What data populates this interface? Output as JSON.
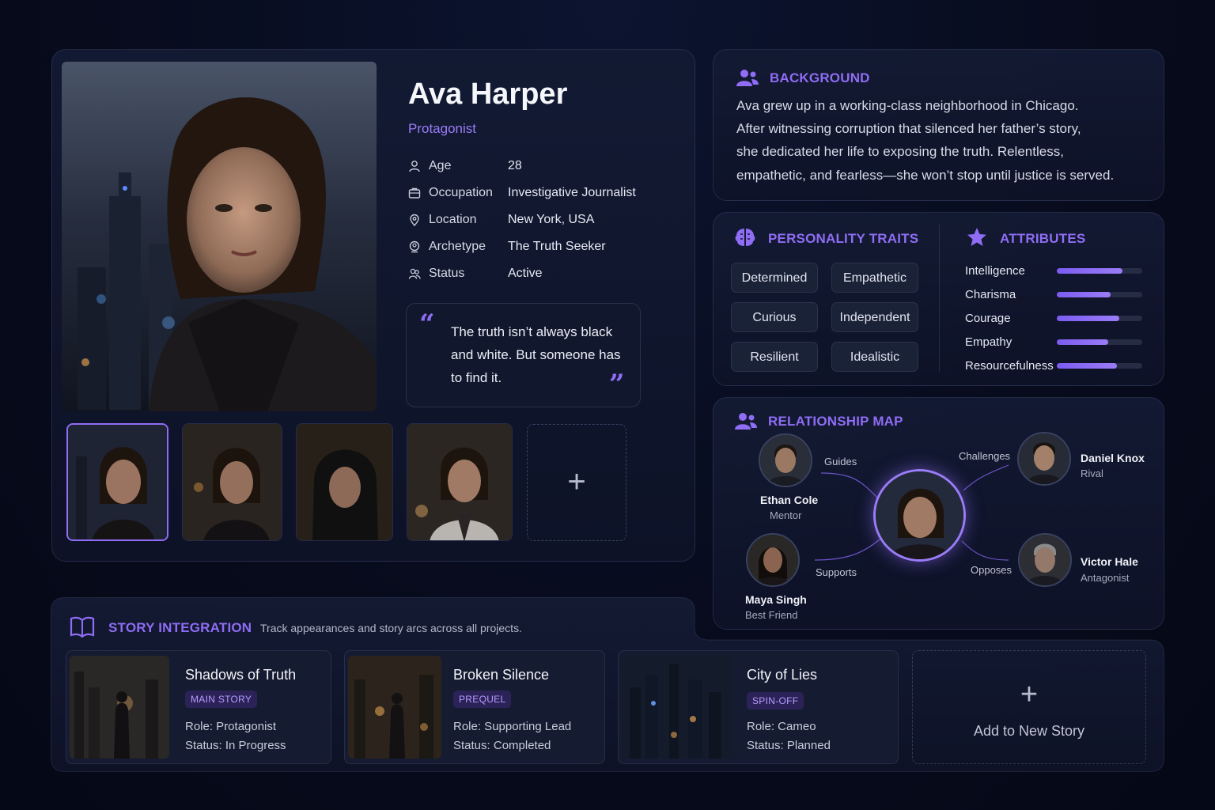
{
  "profile": {
    "name": "Ava Harper",
    "role": "Protagonist",
    "fields": [
      {
        "icon": "person-icon",
        "label": "Age",
        "value": "28"
      },
      {
        "icon": "briefcase-icon",
        "label": "Occupation",
        "value": "Investigative Journalist"
      },
      {
        "icon": "location-pin-icon",
        "label": "Location",
        "value": "New York, USA"
      },
      {
        "icon": "archetype-icon",
        "label": "Archetype",
        "value": "The Truth Seeker"
      },
      {
        "icon": "status-icon",
        "label": "Status",
        "value": "Active"
      }
    ],
    "quote": "The truth isn’t always black and white. But someone has to find it.",
    "quote_lines": [
      "The truth isn’t always black",
      "and white. But someone has",
      "to find it."
    ],
    "quote_open": "“",
    "quote_close": "”"
  },
  "gallery": {
    "add_symbol": "+"
  },
  "background": {
    "title": "BACKGROUND",
    "lines": [
      "Ava grew up in a working-class neighborhood in Chicago.",
      "After witnessing corruption that silenced her father’s story,",
      "she dedicated her life to exposing the truth. Relentless,",
      "empathetic, and fearless—she won’t stop until justice is served."
    ]
  },
  "personality": {
    "title": "PERSONALITY TRAITS",
    "traits": [
      "Determined",
      "Empathetic",
      "Curious",
      "Independent",
      "Resilient",
      "Idealistic"
    ]
  },
  "attributes": {
    "title": "ATTRIBUTES",
    "items": [
      {
        "label": "Intelligence",
        "value": 0.77
      },
      {
        "label": "Charisma",
        "value": 0.63
      },
      {
        "label": "Courage",
        "value": 0.73
      },
      {
        "label": "Empathy",
        "value": 0.6
      },
      {
        "label": "Resourcefulness",
        "value": 0.7
      }
    ]
  },
  "relationships": {
    "title": "RELATIONSHIP MAP",
    "people": [
      {
        "name": "Ethan Cole",
        "role": "Mentor",
        "edge": "Guides"
      },
      {
        "name": "Daniel Knox",
        "role": "Rival",
        "edge": "Challenges"
      },
      {
        "name": "Maya Singh",
        "role": "Best Friend",
        "edge": "Supports"
      },
      {
        "name": "Victor Hale",
        "role": "Antagonist",
        "edge": "Opposes"
      }
    ]
  },
  "story": {
    "title": "STORY INTEGRATION",
    "subtitle": "Track appearances and story arcs across all projects.",
    "cards": [
      {
        "title": "Shadows of Truth",
        "tag": "MAIN STORY",
        "role": "Role: Protagonist",
        "status": "Status: In Progress"
      },
      {
        "title": "Broken Silence",
        "tag": "PREQUEL",
        "role": "Role: Supporting Lead",
        "status": "Status: Completed"
      },
      {
        "title": "City of Lies",
        "tag": "SPIN-OFF",
        "role": "Role: Cameo",
        "status": "Status: Planned"
      }
    ],
    "add_symbol": "+",
    "add_label": "Add to New Story"
  },
  "colors": {
    "accent": "#8f6df5",
    "background": "#070b1c",
    "panel": "#141b34"
  }
}
